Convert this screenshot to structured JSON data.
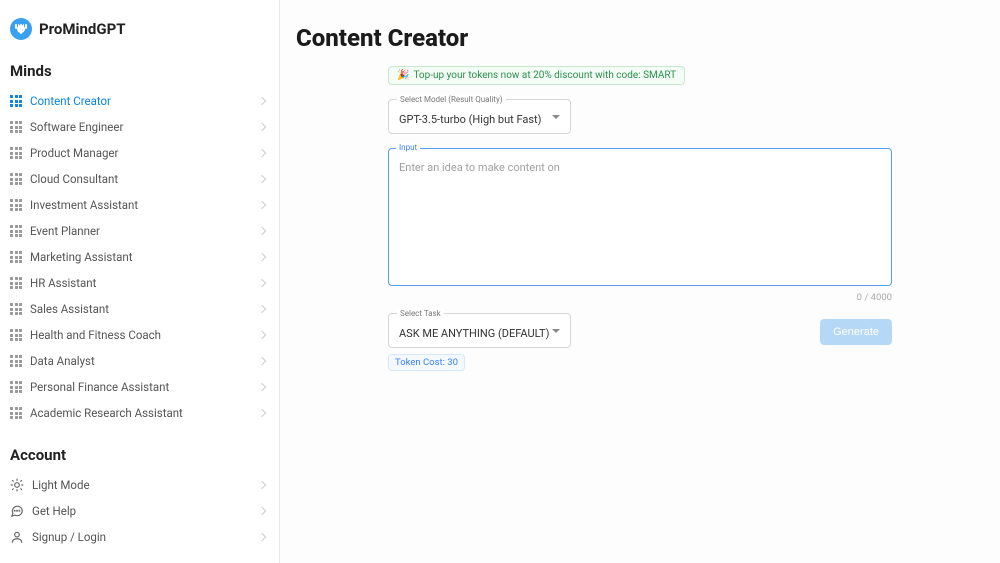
{
  "brand": "ProMindGPT",
  "sections": {
    "minds_title": "Minds",
    "account_title": "Account"
  },
  "minds": [
    {
      "label": "Content Creator",
      "active": true
    },
    {
      "label": "Software Engineer",
      "active": false
    },
    {
      "label": "Product Manager",
      "active": false
    },
    {
      "label": "Cloud Consultant",
      "active": false
    },
    {
      "label": "Investment Assistant",
      "active": false
    },
    {
      "label": "Event Planner",
      "active": false
    },
    {
      "label": "Marketing Assistant",
      "active": false
    },
    {
      "label": "HR Assistant",
      "active": false
    },
    {
      "label": "Sales Assistant",
      "active": false
    },
    {
      "label": "Health and Fitness Coach",
      "active": false
    },
    {
      "label": "Data Analyst",
      "active": false
    },
    {
      "label": "Personal Finance Assistant",
      "active": false
    },
    {
      "label": "Academic Research Assistant",
      "active": false
    }
  ],
  "account_items": [
    {
      "label": "Light Mode",
      "icon": "sun"
    },
    {
      "label": "Get Help",
      "icon": "chat"
    },
    {
      "label": "Signup / Login",
      "icon": "user"
    }
  ],
  "page": {
    "title": "Content Creator"
  },
  "promo": {
    "emoji": "🎉",
    "text": "Top-up your tokens now at 20% discount with code: SMART"
  },
  "model_select": {
    "label": "Select Model (Result Quality)",
    "value": "GPT-3.5-turbo (High but Fast)"
  },
  "input": {
    "label": "Input",
    "placeholder": "Enter an idea to make content on",
    "value": "",
    "char_count": "0 / 4000"
  },
  "task_select": {
    "label": "Select Task",
    "value": "ASK ME ANYTHING (DEFAULT)"
  },
  "token_cost": "Token Cost: 30",
  "generate_label": "Generate"
}
